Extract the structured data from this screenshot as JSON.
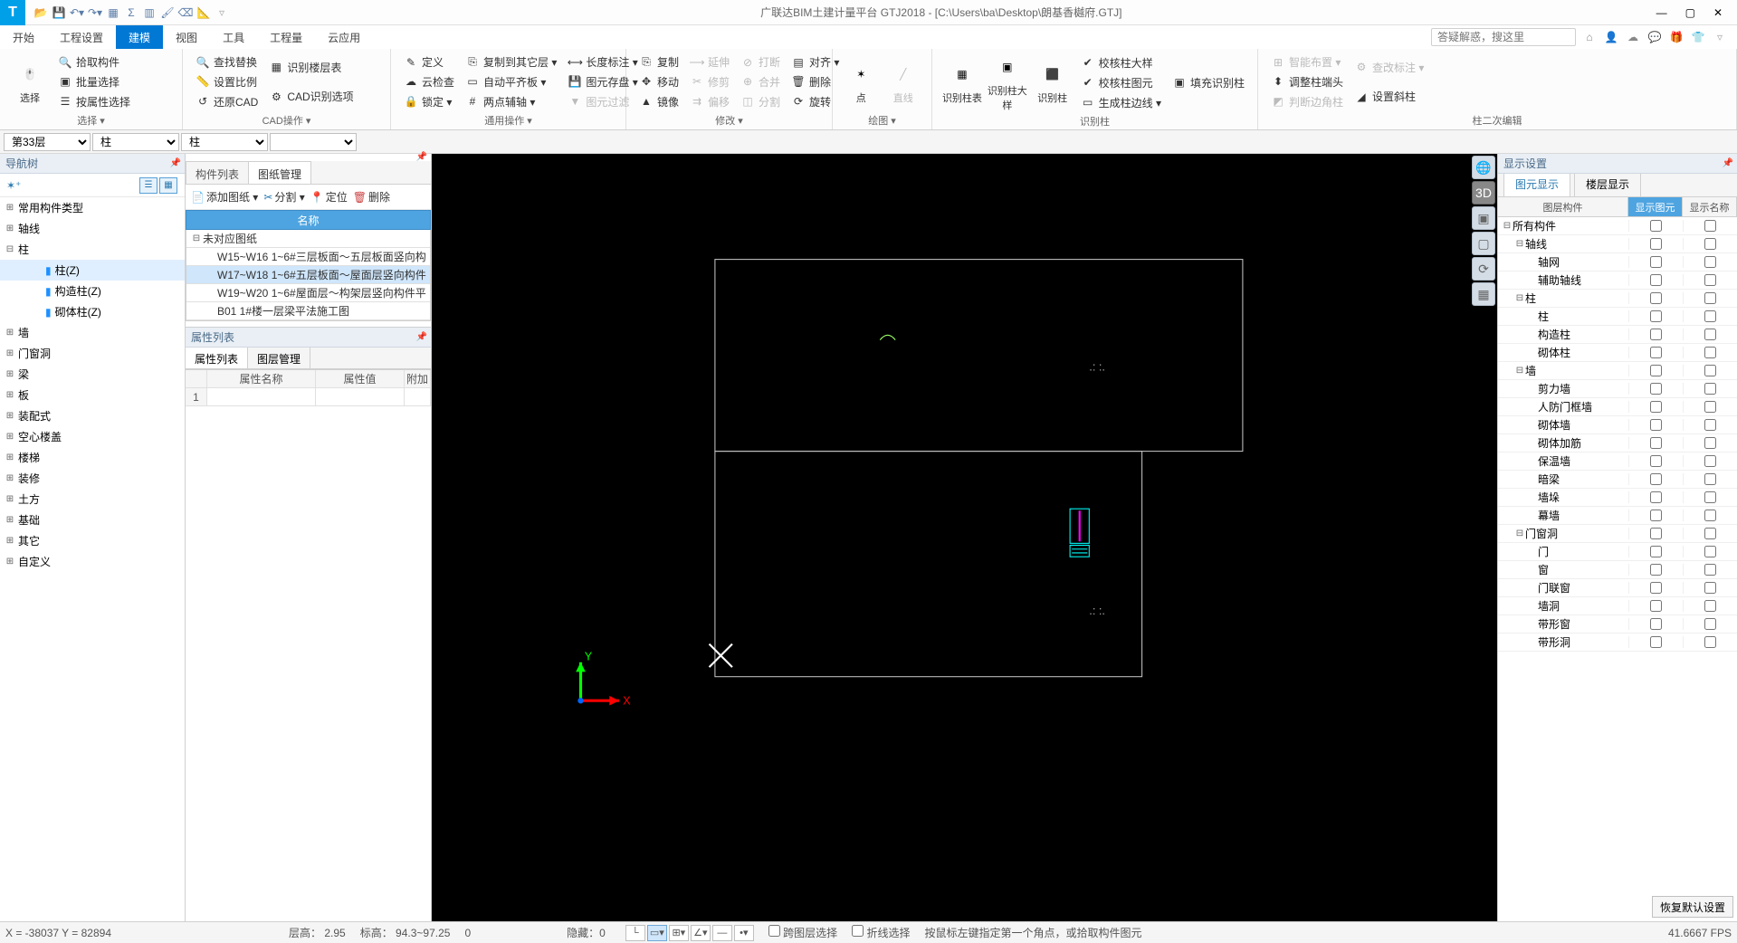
{
  "titlebar": {
    "title": "广联达BIM土建计量平台 GTJ2018 - [C:\\Users\\ba\\Desktop\\朗基香樾府.GTJ]"
  },
  "menubar": {
    "tabs": [
      "开始",
      "工程设置",
      "建模",
      "视图",
      "工具",
      "工程量",
      "云应用"
    ],
    "active": 2,
    "search_placeholder": "答疑解惑，搜这里"
  },
  "ribbon": {
    "select": {
      "big": "选择",
      "items": [
        "拾取构件",
        "批量选择",
        "按属性选择"
      ],
      "label": "选择 ▾"
    },
    "cad": {
      "items": [
        "查找替换",
        "设置比例",
        "还原CAD",
        "识别楼层表",
        "CAD识别选项",
        "定义"
      ],
      "label": "CAD操作 ▾"
    },
    "common": {
      "items": [
        "复制到其它层 ▾",
        "自动平齐板 ▾",
        "两点辅轴 ▾",
        "长度标注 ▾",
        "图元存盘 ▾",
        "图元过滤",
        "云检查",
        "锁定 ▾"
      ],
      "label": "通用操作 ▾"
    },
    "modify": {
      "items": [
        "复制",
        "移动",
        "镜像",
        "延伸",
        "修剪",
        "偏移",
        "打断",
        "合并",
        "分割",
        "对齐 ▾",
        "删除",
        "旋转"
      ],
      "label": "修改 ▾"
    },
    "draw": {
      "items": [
        "点",
        "直线"
      ],
      "label": "绘图 ▾"
    },
    "rec": {
      "items": [
        "识别柱表",
        "识别柱大样",
        "识别柱"
      ],
      "sub": [
        "校核柱大样",
        "校核柱图元",
        "生成柱边线 ▾",
        "填充识别柱"
      ],
      "label": "识别柱"
    },
    "edit2": {
      "items": [
        "智能布置 ▾",
        "调整柱端头",
        "判断边角柱",
        "查改标注 ▾",
        "设置斜柱"
      ],
      "label": "柱二次编辑"
    }
  },
  "selectors": {
    "floor": "第33层",
    "cat": "柱",
    "sub": "柱",
    "name": ""
  },
  "nav": {
    "title": "导航树",
    "items": [
      {
        "t": "常用构件类型",
        "exp": "+",
        "lvl": 0
      },
      {
        "t": "轴线",
        "exp": "+",
        "lvl": 0
      },
      {
        "t": "柱",
        "exp": "-",
        "lvl": 0
      },
      {
        "t": "柱(Z)",
        "lvl": 2,
        "sel": true,
        "ico": "📘"
      },
      {
        "t": "构造柱(Z)",
        "lvl": 2,
        "ico": "📘"
      },
      {
        "t": "砌体柱(Z)",
        "lvl": 2,
        "ico": "📘"
      },
      {
        "t": "墙",
        "exp": "+",
        "lvl": 0
      },
      {
        "t": "门窗洞",
        "exp": "+",
        "lvl": 0
      },
      {
        "t": "梁",
        "exp": "+",
        "lvl": 0
      },
      {
        "t": "板",
        "exp": "+",
        "lvl": 0
      },
      {
        "t": "装配式",
        "exp": "+",
        "lvl": 0
      },
      {
        "t": "空心楼盖",
        "exp": "+",
        "lvl": 0
      },
      {
        "t": "楼梯",
        "exp": "+",
        "lvl": 0
      },
      {
        "t": "装修",
        "exp": "+",
        "lvl": 0
      },
      {
        "t": "土方",
        "exp": "+",
        "lvl": 0
      },
      {
        "t": "基础",
        "exp": "+",
        "lvl": 0
      },
      {
        "t": "其它",
        "exp": "+",
        "lvl": 0
      },
      {
        "t": "自定义",
        "exp": "+",
        "lvl": 0
      }
    ]
  },
  "mid": {
    "tabs": [
      "构件列表",
      "图纸管理"
    ],
    "active": 1,
    "btns": [
      "添加图纸 ▾",
      "分割 ▾",
      "定位",
      "删除"
    ],
    "col": "名称",
    "rows": [
      {
        "t": "未对应图纸",
        "exp": "⊟",
        "lvl": 0
      },
      {
        "t": "W15~W16 1~6#三层板面～五层板面竖向构",
        "lvl": 1
      },
      {
        "t": "W17~W18 1~6#五层板面～屋面层竖向构件",
        "lvl": 1,
        "sel": true
      },
      {
        "t": "W19~W20 1~6#屋面层～构架层竖向构件平",
        "lvl": 1
      },
      {
        "t": "B01 1#楼一层梁平法施工图",
        "lvl": 1
      }
    ],
    "prop": {
      "title": "属性列表",
      "tabs": [
        "属性列表",
        "图层管理"
      ],
      "active": 0,
      "cols": [
        "",
        "属性名称",
        "属性值",
        "附加"
      ]
    }
  },
  "disp": {
    "title": "显示设置",
    "tabs": [
      "图元显示",
      "楼层显示"
    ],
    "active": 0,
    "cols": [
      "图层构件",
      "显示图元",
      "显示名称"
    ],
    "rows": [
      {
        "t": "所有构件",
        "exp": "⊟",
        "lvl": 0
      },
      {
        "t": "轴线",
        "exp": "⊟",
        "lvl": 1
      },
      {
        "t": "轴网",
        "lvl": 2
      },
      {
        "t": "辅助轴线",
        "lvl": 2
      },
      {
        "t": "柱",
        "exp": "⊟",
        "lvl": 1
      },
      {
        "t": "柱",
        "lvl": 2
      },
      {
        "t": "构造柱",
        "lvl": 2
      },
      {
        "t": "砌体柱",
        "lvl": 2
      },
      {
        "t": "墙",
        "exp": "⊟",
        "lvl": 1
      },
      {
        "t": "剪力墙",
        "lvl": 2
      },
      {
        "t": "人防门框墙",
        "lvl": 2
      },
      {
        "t": "砌体墙",
        "lvl": 2
      },
      {
        "t": "砌体加筋",
        "lvl": 2
      },
      {
        "t": "保温墙",
        "lvl": 2
      },
      {
        "t": "暗梁",
        "lvl": 2
      },
      {
        "t": "墙垛",
        "lvl": 2
      },
      {
        "t": "幕墙",
        "lvl": 2
      },
      {
        "t": "门窗洞",
        "exp": "⊟",
        "lvl": 1
      },
      {
        "t": "门",
        "lvl": 2
      },
      {
        "t": "窗",
        "lvl": 2
      },
      {
        "t": "门联窗",
        "lvl": 2
      },
      {
        "t": "墙洞",
        "lvl": 2
      },
      {
        "t": "带形窗",
        "lvl": 2
      },
      {
        "t": "带形洞",
        "lvl": 2
      }
    ],
    "footer": "恢复默认设置"
  },
  "status": {
    "coord": "X = -38037 Y = 82894",
    "floor": "层高：  2.95",
    "elev": "标高：  94.3~97.25",
    "zero": "0",
    "hide": "隐藏：0",
    "cross": "跨图层选择",
    "polyline": "折线选择",
    "hint": "按鼠标左键指定第一个角点，或拾取构件图元",
    "fps": "41.6667 FPS"
  }
}
